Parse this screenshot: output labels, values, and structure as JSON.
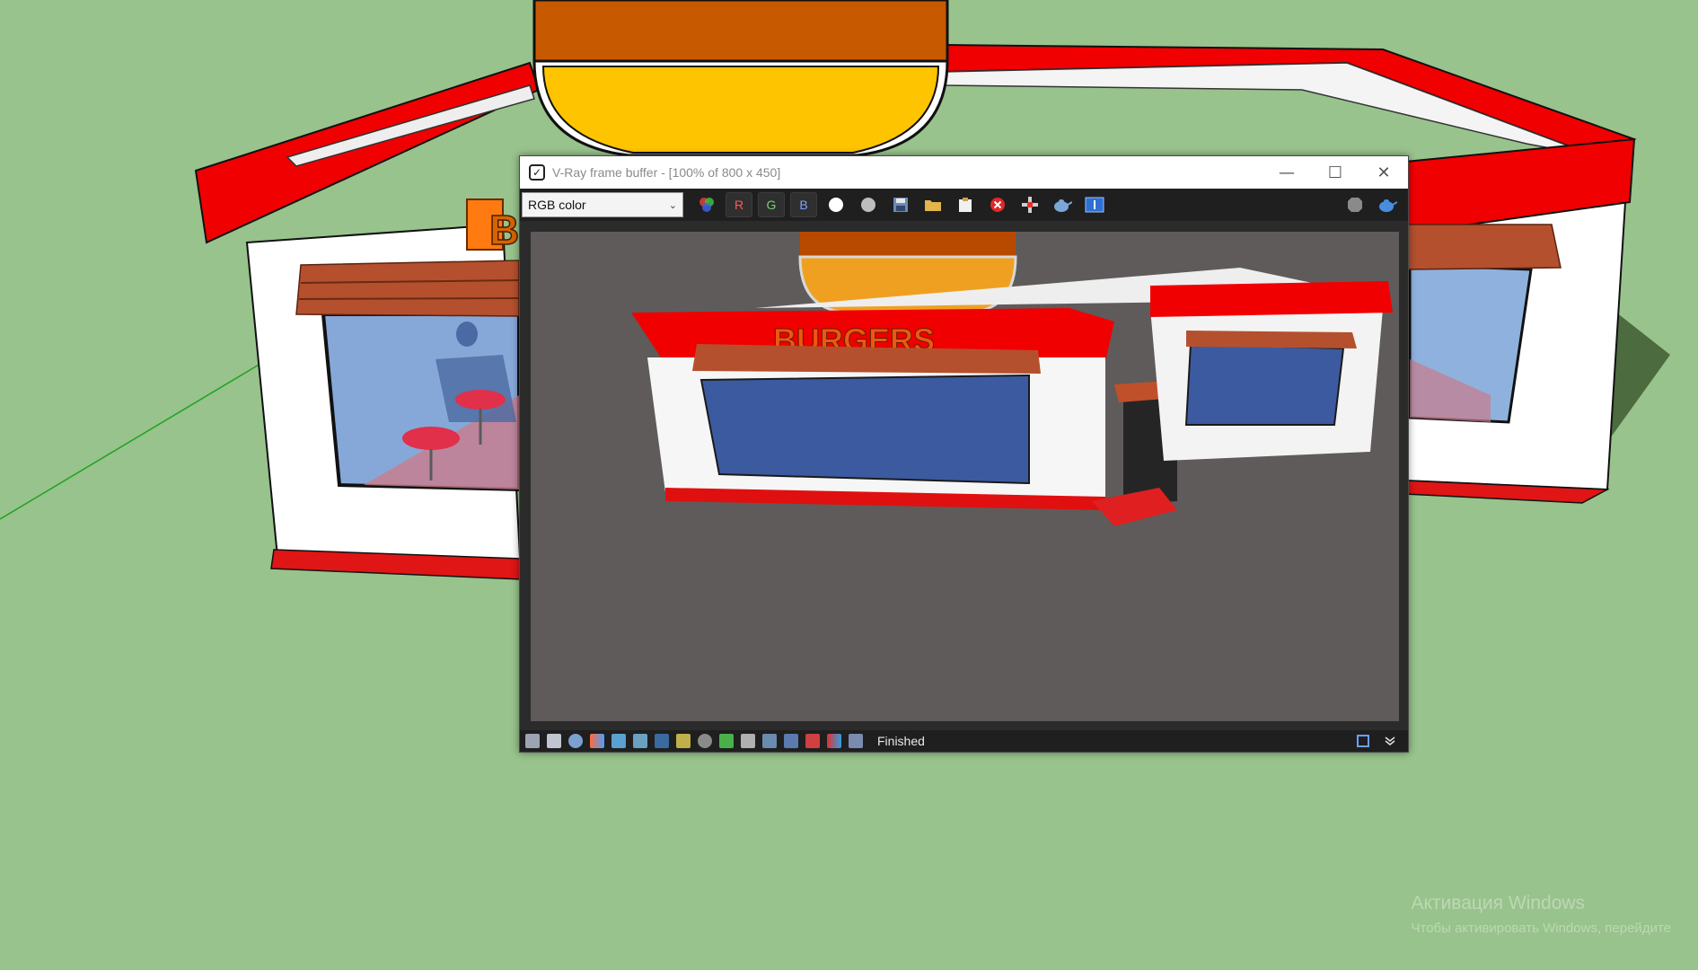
{
  "window": {
    "title": "V-Ray frame buffer - [100% of 800 x 450]",
    "minimize": "—",
    "maximize": "☐",
    "close": "✕"
  },
  "toolbar": {
    "channel": "RGB color",
    "channel_chevron": "⌄",
    "r_label": "R",
    "g_label": "G",
    "b_label": "B"
  },
  "render": {
    "sign_text": "BURGERS"
  },
  "viewport": {
    "sign_fragment": "B"
  },
  "status": {
    "text": "Finished"
  },
  "watermark": {
    "line1": "Активация Windows",
    "line2": "Чтобы активировать Windows, перейдите"
  },
  "colors": {
    "sky_ground": "#98c38c",
    "building_red": "#f00000",
    "awning": "#b4502e",
    "window_blue": "#3c5aa0",
    "dome_orange": "#c75a00",
    "dome_yellow": "#ffc400"
  }
}
